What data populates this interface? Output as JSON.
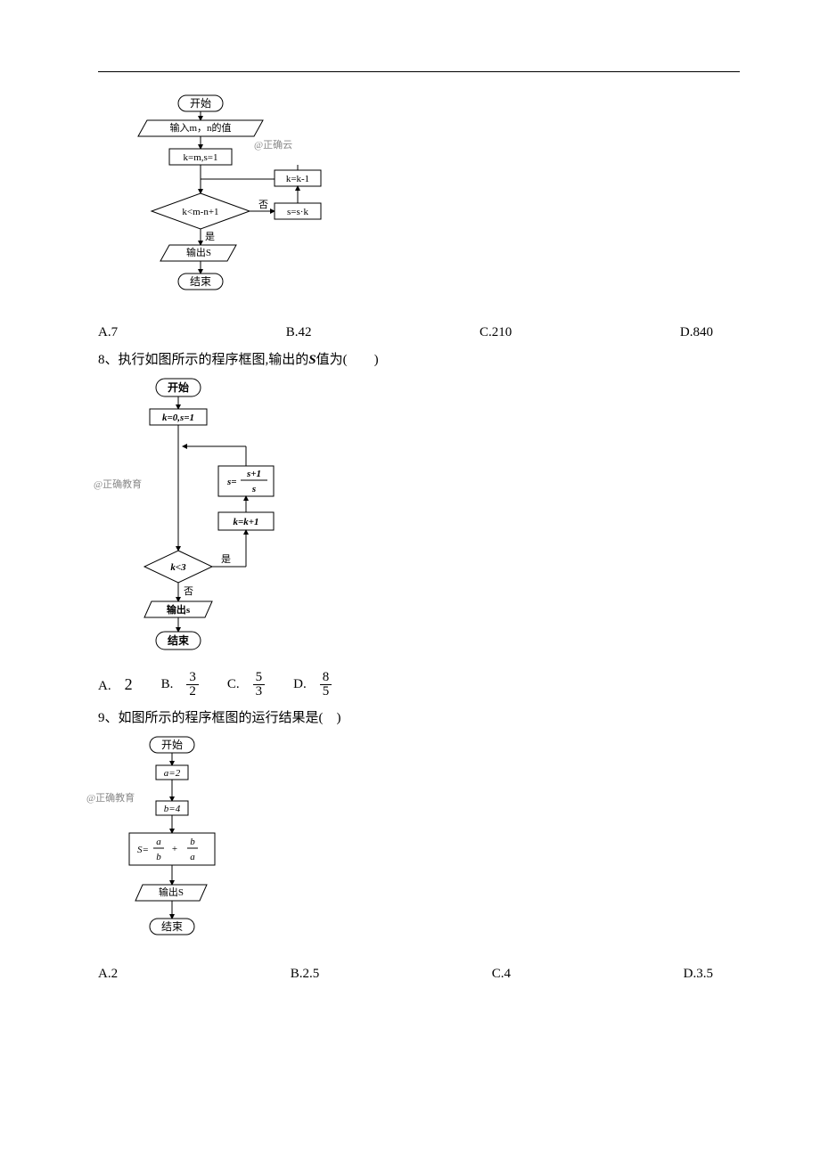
{
  "q7": {
    "watermark": "@正确云",
    "fc": {
      "start": "开始",
      "input": "输入m，n的值",
      "init": "k=m,s=1",
      "cond": "k<m-n+1",
      "upd1": "s=s·k",
      "upd2": "k=k-1",
      "no": "否",
      "yes": "是",
      "out": "输出S",
      "end": "结束"
    },
    "opts": {
      "A": "A.7",
      "B": "B.42",
      "C": "C.210",
      "D": "D.840"
    }
  },
  "q8": {
    "stem_pre": "8、执行如图所示的程序框图,输出的",
    "stem_var": "S",
    "stem_post": "值为(　　)",
    "watermark": "@正确教育",
    "fc": {
      "start": "开始",
      "init": "k=0,s=1",
      "upd1_top": "s+1",
      "upd1_bot": "s",
      "upd1_pre": "s=",
      "upd2": "k=k+1",
      "cond": "k<3",
      "yes": "是",
      "no": "否",
      "out": "输出s",
      "end": "结束"
    },
    "opts": {
      "A_pre": "A.　",
      "A_val": "2",
      "B_pre": "B.　",
      "B_num": "3",
      "B_den": "2",
      "C_pre": "C.　",
      "C_num": "5",
      "C_den": "3",
      "D_pre": "D.　",
      "D_num": "8",
      "D_den": "5"
    }
  },
  "q9": {
    "stem": "9、如图所示的程序框图的运行结果是(　)",
    "watermark": "@正确教育",
    "fc": {
      "start": "开始",
      "a": "a=2",
      "b": "b=4",
      "S_eq": "S=",
      "frac1_num": "a",
      "frac1_den": "b",
      "plus": " + ",
      "frac2_num": "b",
      "frac2_den": "a",
      "out": "输出S",
      "end": "结束"
    },
    "opts": {
      "A": "A.2",
      "B": "B.2.5",
      "C": "C.4",
      "D": "D.3.5"
    }
  }
}
